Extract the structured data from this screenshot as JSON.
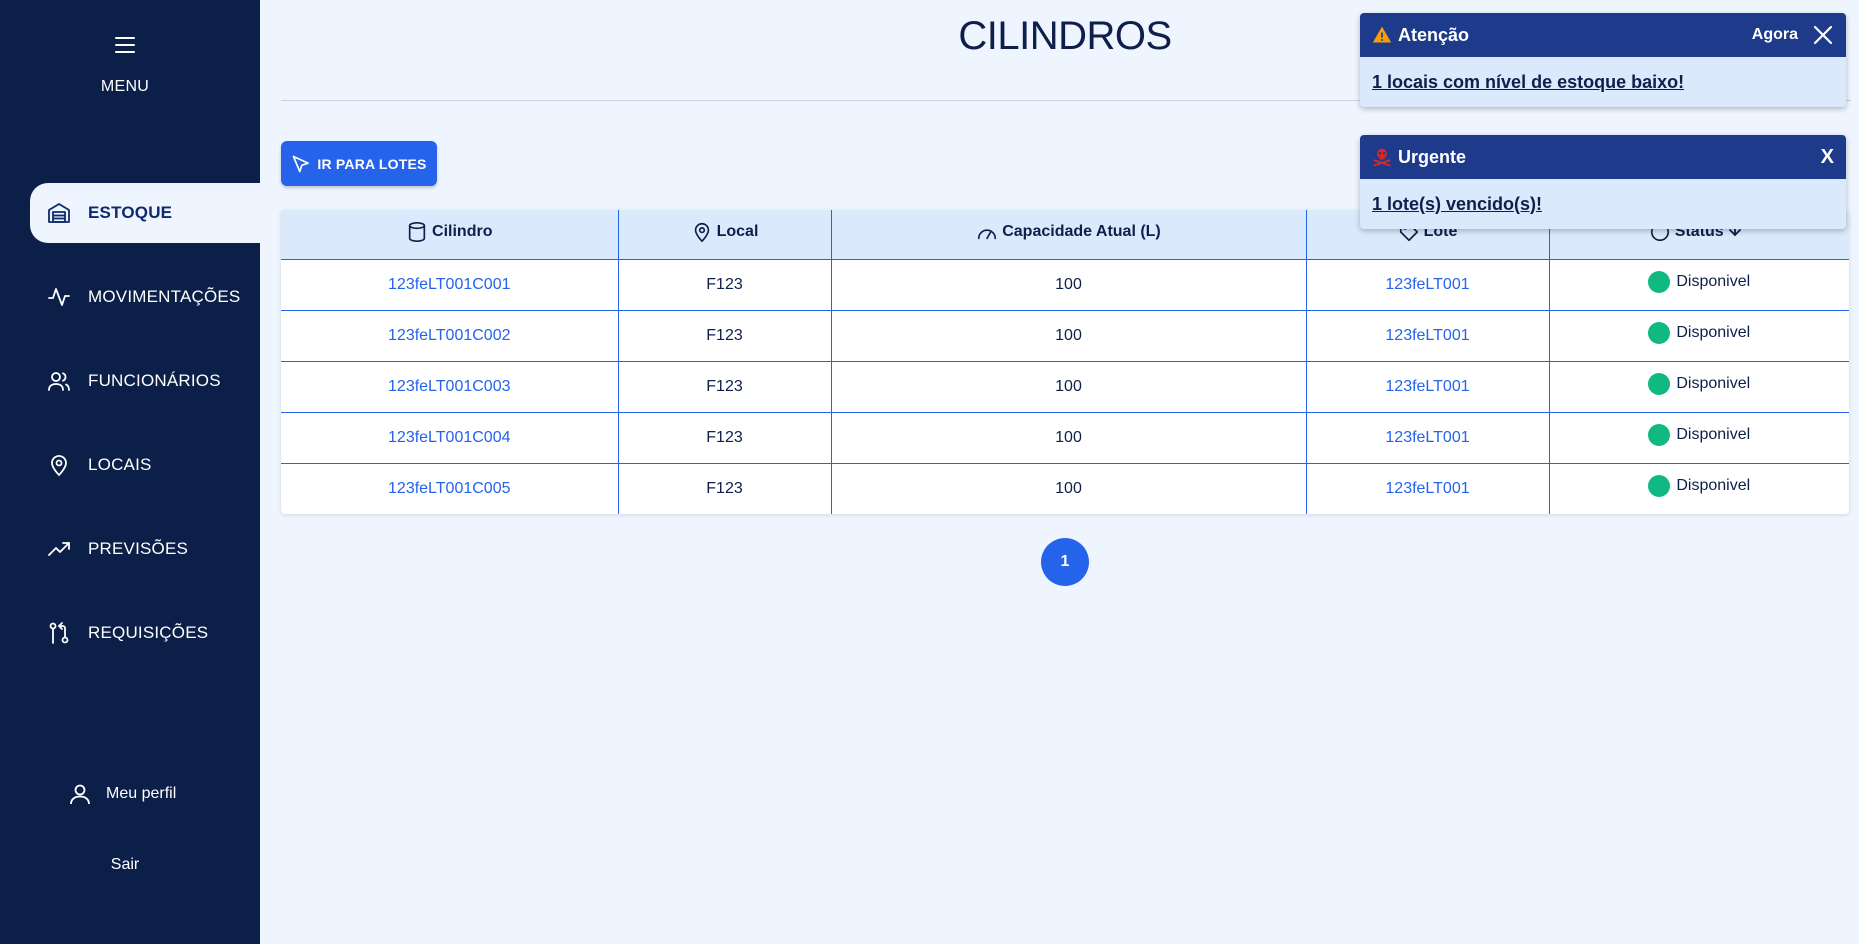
{
  "sidebar": {
    "menu_label": "MENU",
    "items": [
      {
        "label": "ESTOQUE",
        "icon": "warehouse-icon",
        "active": true
      },
      {
        "label": "MOVIMENTAÇÕES",
        "icon": "activity-icon",
        "active": false
      },
      {
        "label": "FUNCIONÁRIOS",
        "icon": "users-icon",
        "active": false
      },
      {
        "label": "LOCAIS",
        "icon": "map-pin-icon",
        "active": false
      },
      {
        "label": "PREVISÕES",
        "icon": "trending-up-icon",
        "active": false
      },
      {
        "label": "REQUISIÇÕES",
        "icon": "git-pull-request-icon",
        "active": false
      }
    ],
    "profile_label": "Meu perfil",
    "logout_label": "Sair"
  },
  "header": {
    "title": "CILINDROS"
  },
  "toolbar": {
    "lotes_button_label": "IR PARA LOTES"
  },
  "table": {
    "columns": [
      {
        "label": "Cilindro",
        "icon": "cylinder-icon"
      },
      {
        "label": "Local",
        "icon": "map-pin-icon"
      },
      {
        "label": "Capacidade Atual (L)",
        "icon": "gauge-icon"
      },
      {
        "label": "Lote",
        "icon": "tag-icon"
      },
      {
        "label": "Status",
        "icon": "circle-icon",
        "sort": "arrow-down-icon"
      }
    ],
    "rows": [
      {
        "cilindro": "123feLT001C001",
        "local": "F123",
        "capacidade": "100",
        "lote": "123feLT001",
        "status": "Disponivel"
      },
      {
        "cilindro": "123feLT001C002",
        "local": "F123",
        "capacidade": "100",
        "lote": "123feLT001",
        "status": "Disponivel"
      },
      {
        "cilindro": "123feLT001C003",
        "local": "F123",
        "capacidade": "100",
        "lote": "123feLT001",
        "status": "Disponivel"
      },
      {
        "cilindro": "123feLT001C004",
        "local": "F123",
        "capacidade": "100",
        "lote": "123feLT001",
        "status": "Disponivel"
      },
      {
        "cilindro": "123feLT001C005",
        "local": "F123",
        "capacidade": "100",
        "lote": "123feLT001",
        "status": "Disponivel"
      }
    ],
    "status_color": "#10b981"
  },
  "pagination": {
    "current_page": "1"
  },
  "toasts": {
    "attention": {
      "title": "Atenção",
      "time": "Agora",
      "message": "1 locais com nível de estoque baixo!",
      "icon": "warning-icon",
      "icon_color": "#f59e0b"
    },
    "urgent": {
      "title": "Urgente",
      "close_label": "X",
      "message": "1 lote(s) vencido(s)!",
      "icon": "skull-crossbones-icon",
      "icon_color": "#dc2626"
    }
  },
  "colors": {
    "sidebar_bg": "#0c1f48",
    "accent": "#2563eb",
    "page_bg": "#eef5fe",
    "toast_header": "#1e3a8a"
  }
}
